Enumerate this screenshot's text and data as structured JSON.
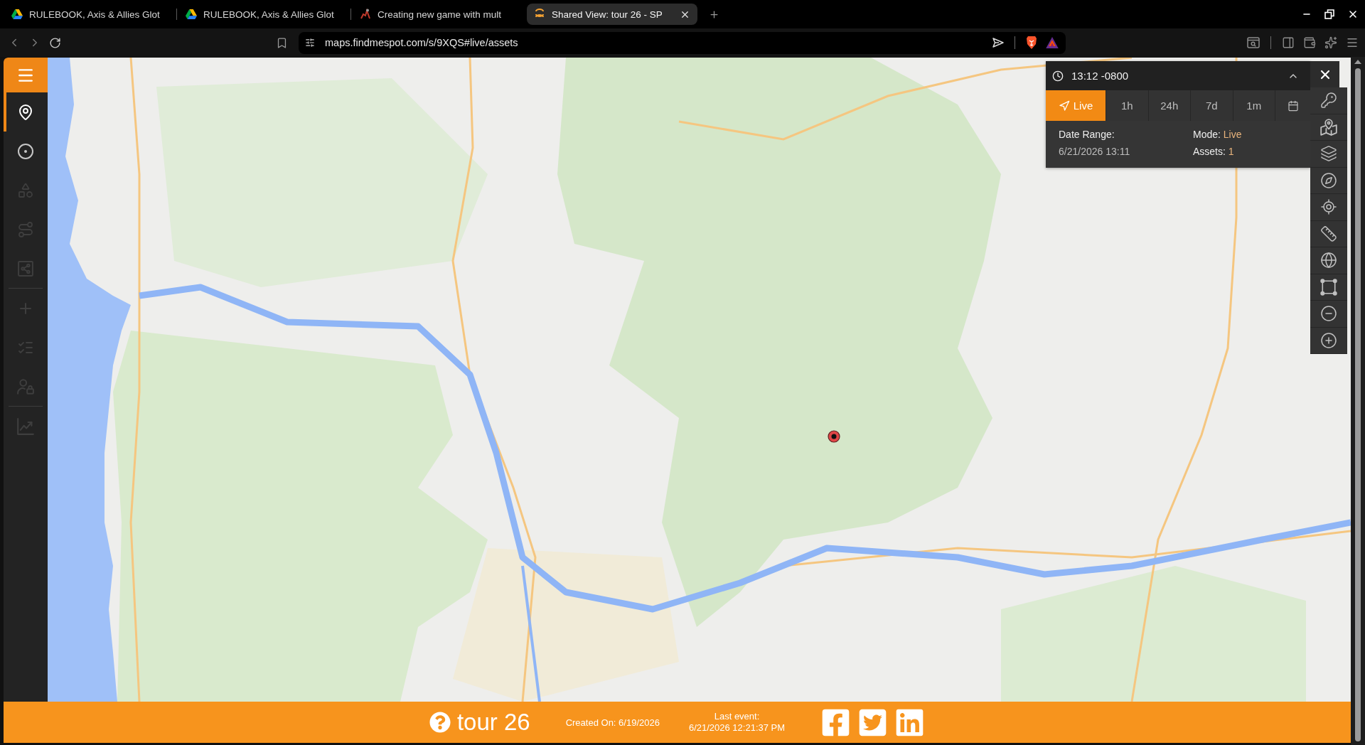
{
  "browser": {
    "tabs": [
      {
        "title": "RULEBOOK, Axis & Allies Glot",
        "selected": false
      },
      {
        "title": "RULEBOOK, Axis & Allies Glot",
        "selected": false
      },
      {
        "title": "Creating new game with mult",
        "selected": false
      },
      {
        "title": "Shared View: tour 26 - SP",
        "selected": true
      }
    ],
    "address_bar": {
      "url": "maps.findmespot.com/s/9XQS#live/assets"
    }
  },
  "sidebar": {
    "groups": [
      {
        "items": [
          {
            "selected": true,
            "disabled": false
          },
          {
            "selected": false,
            "disabled": false
          },
          {
            "selected": false,
            "disabled": true
          },
          {
            "selected": false,
            "disabled": true
          },
          {
            "selected": false,
            "disabled": true
          }
        ]
      },
      {
        "items": [
          {
            "selected": false,
            "disabled": true
          },
          {
            "selected": false,
            "disabled": true
          },
          {
            "selected": false,
            "disabled": true
          }
        ]
      },
      {
        "items": [
          {
            "selected": false,
            "disabled": true
          }
        ]
      }
    ]
  },
  "time_panel": {
    "time": "13:12 -0800",
    "ranges": [
      {
        "kind": "live",
        "label": "Live",
        "selected": true
      },
      {
        "kind": "period",
        "label": "1h",
        "selected": false
      },
      {
        "kind": "period",
        "label": "24h",
        "selected": false
      },
      {
        "kind": "period",
        "label": "7d",
        "selected": false
      },
      {
        "kind": "period",
        "label": "1m",
        "selected": false
      }
    ],
    "date_range": {
      "label": "Date Range:",
      "value": "6/21/2026 13:11"
    },
    "mode": {
      "label": "Mode:",
      "value": "Live"
    },
    "assets": {
      "label": "Assets:",
      "value": "1"
    }
  },
  "footer": {
    "title": "tour 26",
    "created": "Created On: 6/19/2026",
    "last_event": {
      "label": "Last event:",
      "time": "6/21/2026 12:21:37 PM"
    }
  }
}
